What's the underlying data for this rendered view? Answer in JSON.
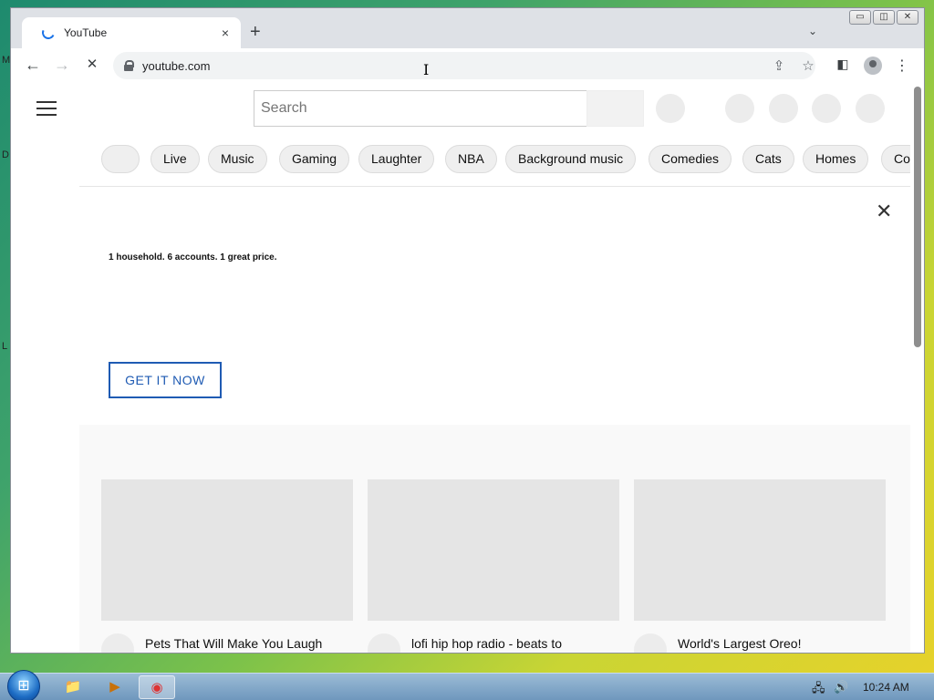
{
  "desktop": {
    "edge_letters": [
      "M",
      "D",
      "L"
    ]
  },
  "browser": {
    "tab": {
      "title": "YouTube",
      "close_icon": "×"
    },
    "new_tab_icon": "+",
    "tab_menu_icon": "⌄",
    "window_controls": [
      "▭",
      "◫",
      "✕"
    ],
    "toolbar": {
      "back_icon": "←",
      "forward_icon": "→",
      "stop_icon": "✕",
      "url": "youtube.com",
      "share_icon": "⇪",
      "bookmark_icon": "☆",
      "sidepanel_icon": "◧",
      "menu_icon": "⋮"
    }
  },
  "youtube": {
    "search": {
      "placeholder": "Search"
    },
    "chips": [
      "",
      "Live",
      "Music",
      "Gaming",
      "Laughter",
      "NBA",
      "Background music",
      "Comedies",
      "Cats",
      "Homes",
      "Co"
    ],
    "banner": {
      "headline": "1 household. 6 accounts. 1 great price.",
      "cta": "GET IT NOW",
      "close_icon": "✕"
    },
    "videos": [
      {
        "title": "Pets That Will Make You Laugh Until Your Out of Breath"
      },
      {
        "title": "lofi hip hop radio - beats to relax/study to"
      },
      {
        "title": "World's Largest Oreo!"
      }
    ]
  },
  "taskbar": {
    "start_icon": "⊞",
    "apps": [
      "📁",
      "▶",
      "◉"
    ],
    "tray_icons": [
      "🖧",
      "🔊"
    ],
    "clock": "10:24 AM"
  }
}
